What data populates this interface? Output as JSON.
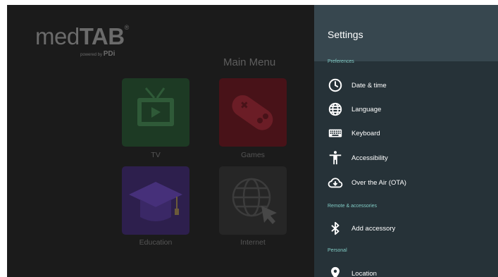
{
  "launcher": {
    "brand": {
      "name_light": "med",
      "name_bold": "TAB",
      "reg": "®",
      "powered_by": "powered by",
      "powered_brand": "PDi"
    },
    "menu_title": "Main Menu",
    "tiles": [
      {
        "label": "TV",
        "icon": "tv-icon",
        "color": "#1d3a24"
      },
      {
        "label": "Games",
        "icon": "gamepad-icon",
        "color": "#481218"
      },
      {
        "label": "Education",
        "icon": "graduation-cap-icon",
        "color": "#2d1f4d"
      },
      {
        "label": "Internet",
        "icon": "globe-cursor-icon",
        "color": "#262626"
      }
    ]
  },
  "settings": {
    "title": "Settings",
    "sections": {
      "preferences": "Preferences",
      "remote": "Remote & accessories",
      "personal": "Personal"
    },
    "items": [
      {
        "label": "Date & time",
        "icon": "clock-icon"
      },
      {
        "label": "Language",
        "icon": "globe-icon"
      },
      {
        "label": "Keyboard",
        "icon": "keyboard-icon"
      },
      {
        "label": "Accessibility",
        "icon": "accessibility-icon"
      },
      {
        "label": "Over the Air (OTA)",
        "icon": "cloud-download-icon"
      },
      {
        "label": "Add accessory",
        "icon": "bluetooth-icon"
      },
      {
        "label": "Location",
        "icon": "location-pin-icon"
      }
    ]
  },
  "colors": {
    "panel": "#263238",
    "header": "#37474f",
    "section_text": "#80cbc4"
  }
}
